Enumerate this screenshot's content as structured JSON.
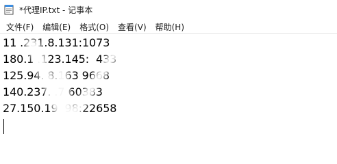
{
  "window": {
    "title": "*代理IP.txt - 记事本"
  },
  "menu": {
    "items": [
      {
        "label": "文件(F)"
      },
      {
        "label": "编辑(E)"
      },
      {
        "label": "格式(O)"
      },
      {
        "label": "查看(V)"
      },
      {
        "label": "帮助(H)"
      }
    ]
  },
  "document": {
    "lines": [
      "11 .231.8.131:1073",
      "180.1 .123.145:  433",
      "125.94. 8.163 9668",
      "140.237. .7 60383",
      "27.150.19  98:22658"
    ]
  },
  "icons": {
    "app": "notepad-icon"
  }
}
